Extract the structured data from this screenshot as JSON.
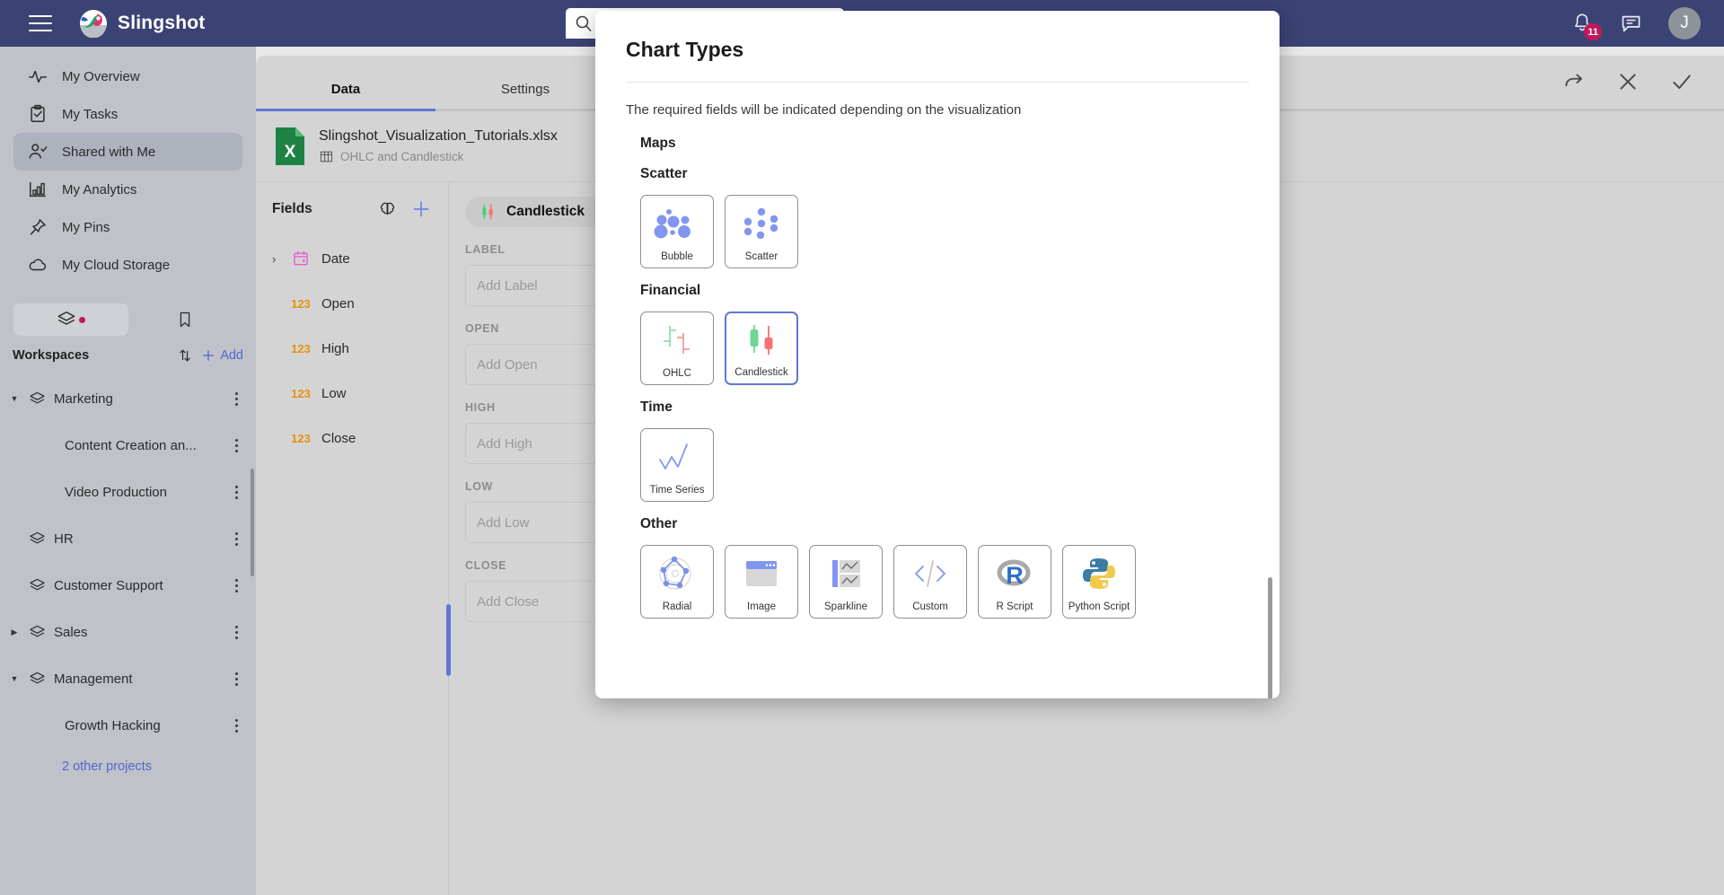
{
  "topbar": {
    "brand": "Slingshot",
    "search_placeholder": "",
    "search_value": "",
    "notification_count": "11",
    "avatar_initial": "J"
  },
  "sidebar": {
    "nav_items": [
      {
        "label": "My Overview",
        "icon": "activity-icon",
        "active": false
      },
      {
        "label": "My Tasks",
        "icon": "clipboard-check-icon",
        "active": false
      },
      {
        "label": "Shared with Me",
        "icon": "user-check-icon",
        "active": true
      },
      {
        "label": "My Analytics",
        "icon": "bar-chart-icon",
        "active": false
      },
      {
        "label": "My Pins",
        "icon": "pin-icon",
        "active": false
      },
      {
        "label": "My Cloud Storage",
        "icon": "cloud-icon",
        "active": false
      }
    ],
    "segment": {
      "workspaces_icon": "layers-icon",
      "bookmarks_icon": "bookmark-icon"
    },
    "workspaces_title": "Workspaces",
    "sort_icon": "sort-arrows-icon",
    "add_label": "Add",
    "tree": [
      {
        "label": "Marketing",
        "level": 0,
        "caret": "down"
      },
      {
        "label": "Content Creation an...",
        "level": 1,
        "caret": "none"
      },
      {
        "label": "Video Production",
        "level": 1,
        "caret": "none"
      },
      {
        "label": "HR",
        "level": 0,
        "caret": "none"
      },
      {
        "label": "Customer Support",
        "level": 0,
        "caret": "none"
      },
      {
        "label": "Sales",
        "level": 0,
        "caret": "right"
      },
      {
        "label": "Management",
        "level": 0,
        "caret": "down"
      },
      {
        "label": "Growth Hacking",
        "level": 1,
        "caret": "none"
      }
    ],
    "other_projects": "2 other projects"
  },
  "editor": {
    "tabs": [
      {
        "label": "Data",
        "active": true
      },
      {
        "label": "Settings",
        "active": false
      }
    ],
    "file": {
      "name": "Slingshot_Visualization_Tutorials.xlsx",
      "sheet": "OHLC and Candlestick",
      "icon": "excel-file-icon",
      "sheet_icon": "table-icon"
    },
    "fields": {
      "title": "Fields",
      "ai_icon": "brain-icon",
      "add_icon": "plus-icon",
      "items": [
        {
          "name": "Date",
          "type": "date",
          "type_label": "",
          "caret": true
        },
        {
          "name": "Open",
          "type": "number",
          "type_label": "123",
          "caret": false
        },
        {
          "name": "High",
          "type": "number",
          "type_label": "123",
          "caret": false
        },
        {
          "name": "Low",
          "type": "number",
          "type_label": "123",
          "caret": false
        },
        {
          "name": "Close",
          "type": "number",
          "type_label": "123",
          "caret": false
        }
      ]
    },
    "viz": {
      "name": "Candlestick",
      "icon": "candlestick-icon",
      "chevron": "chevron-down-icon"
    },
    "drops": [
      {
        "label": "LABEL",
        "placeholder": "Add Label",
        "has_plus": false
      },
      {
        "label": "OPEN",
        "placeholder": "Add Open",
        "has_plus": false
      },
      {
        "label": "HIGH",
        "placeholder": "Add High",
        "has_plus": false
      },
      {
        "label": "LOW",
        "placeholder": "Add Low",
        "has_plus": false
      },
      {
        "label": "CLOSE",
        "placeholder": "Add Close",
        "has_plus": true
      }
    ],
    "actions": {
      "redo_icon": "redo-icon",
      "close_icon": "close-icon",
      "confirm_icon": "check-icon"
    }
  },
  "modal": {
    "title": "Chart Types",
    "subtitle": "The required fields will be indicated depending on the visualization",
    "sections": [
      {
        "name": "Maps",
        "cards": []
      },
      {
        "name": "Scatter",
        "cards": [
          {
            "label": "Bubble",
            "art": "bubble",
            "selected": false
          },
          {
            "label": "Scatter",
            "art": "scatter",
            "selected": false
          }
        ]
      },
      {
        "name": "Financial",
        "cards": [
          {
            "label": "OHLC",
            "art": "ohlc",
            "selected": false
          },
          {
            "label": "Candlestick",
            "art": "candlestick",
            "selected": true
          }
        ]
      },
      {
        "name": "Time",
        "cards": [
          {
            "label": "Time Series",
            "art": "timeseries",
            "selected": false
          }
        ]
      },
      {
        "name": "Other",
        "cards": [
          {
            "label": "Radial",
            "art": "radial",
            "selected": false
          },
          {
            "label": "Image",
            "art": "image",
            "selected": false
          },
          {
            "label": "Sparkline",
            "art": "sparkline",
            "selected": false
          },
          {
            "label": "Custom",
            "art": "custom",
            "selected": false
          },
          {
            "label": "R Script",
            "art": "rscript",
            "selected": false
          },
          {
            "label": "Python Script",
            "art": "python",
            "selected": false
          }
        ]
      }
    ]
  },
  "colors": {
    "brand_navy": "#3b4375",
    "accent_blue": "#6276d6",
    "badge_pink": "#c2185b",
    "up_green": "#6ed694",
    "down_red": "#f87272",
    "number_orange": "#e8920a",
    "date_magenta": "#e45bd0"
  }
}
